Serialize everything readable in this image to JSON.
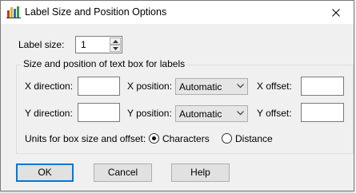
{
  "window": {
    "title": "Label Size and Position Options"
  },
  "label_size": {
    "label": "Label size:",
    "value": "1"
  },
  "group": {
    "title": "Size and position of text box for labels",
    "x_direction_label": "X direction:",
    "x_direction_value": "",
    "x_position_label": "X position:",
    "x_position_value": "Automatic",
    "x_offset_label": "X offset:",
    "x_offset_value": "",
    "y_direction_label": "Y direction:",
    "y_direction_value": "",
    "y_position_label": "Y position:",
    "y_position_value": "Automatic",
    "y_offset_label": "Y offset:",
    "y_offset_value": "",
    "units_label": "Units for box size and offset:",
    "units_options": [
      "Characters",
      "Distance"
    ],
    "units_selected": "Characters"
  },
  "buttons": {
    "ok": "OK",
    "cancel": "Cancel",
    "help": "Help"
  },
  "colors": {
    "accent": "#0078d7",
    "window_bg": "#f0f0f0"
  }
}
